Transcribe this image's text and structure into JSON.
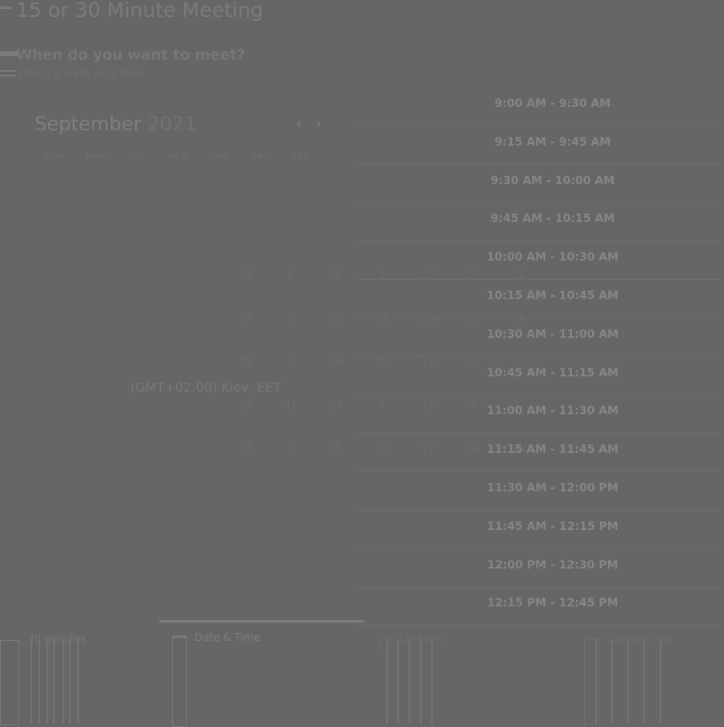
{
  "header": {
    "title": "15 or 30 Minute Meeting",
    "question": "When do you want to meet?",
    "subtitle": "Select a date and time"
  },
  "calendar": {
    "month": "September",
    "year": "2021",
    "prev_icon": "chevron-left-icon",
    "next_icon": "chevron-right-icon",
    "weekdays": [
      "SUN",
      "MON",
      "TUE",
      "WED",
      "THU",
      "FRI",
      "SAT"
    ],
    "rows": [
      [
        "25",
        "6",
        "9",
        "3",
        "30",
        "5",
        "16"
      ],
      [
        "27",
        "2",
        "29",
        "21",
        "23",
        "2",
        "16"
      ],
      [
        "29",
        "9",
        "26",
        "19",
        "18",
        "31",
        "13"
      ],
      [
        "14",
        "31",
        "23",
        "5",
        "12",
        "3",
        "31"
      ],
      [
        "18",
        "9",
        "4",
        "29",
        "17",
        "24",
        "29"
      ]
    ]
  },
  "timezone": "(GMT+02:00) Kiev, EET",
  "slots": [
    "9:00 AM - 9:30 AM",
    "9:15 AM - 9:45 AM",
    "9:30 AM - 10:00 AM",
    "9:45 AM - 10:15 AM",
    "10:00 AM - 10:30 AM",
    "10:15 AM - 10:45 AM",
    "10:30 AM - 11:00 AM",
    "10:45 AM - 11:15 AM",
    "11:00 AM - 11:30 AM",
    "11:15 AM - 11:45 AM",
    "11:30 AM - 12:00 PM",
    "11:45 AM - 12:15 PM",
    "12:00 PM - 12:30 PM",
    "12:15 PM - 12:45 PM"
  ],
  "steps": [
    {
      "label": "30 minutes",
      "icon": "clock-icon"
    },
    {
      "label": "Date & Time",
      "icon": "calendar-icon"
    },
    {
      "label": "Location",
      "icon": "location-pin-icon"
    },
    {
      "label": "Confirm Info",
      "icon": "checklist-icon"
    }
  ],
  "colors": {
    "background": "#666666",
    "active_step": "#7e7e7e"
  }
}
